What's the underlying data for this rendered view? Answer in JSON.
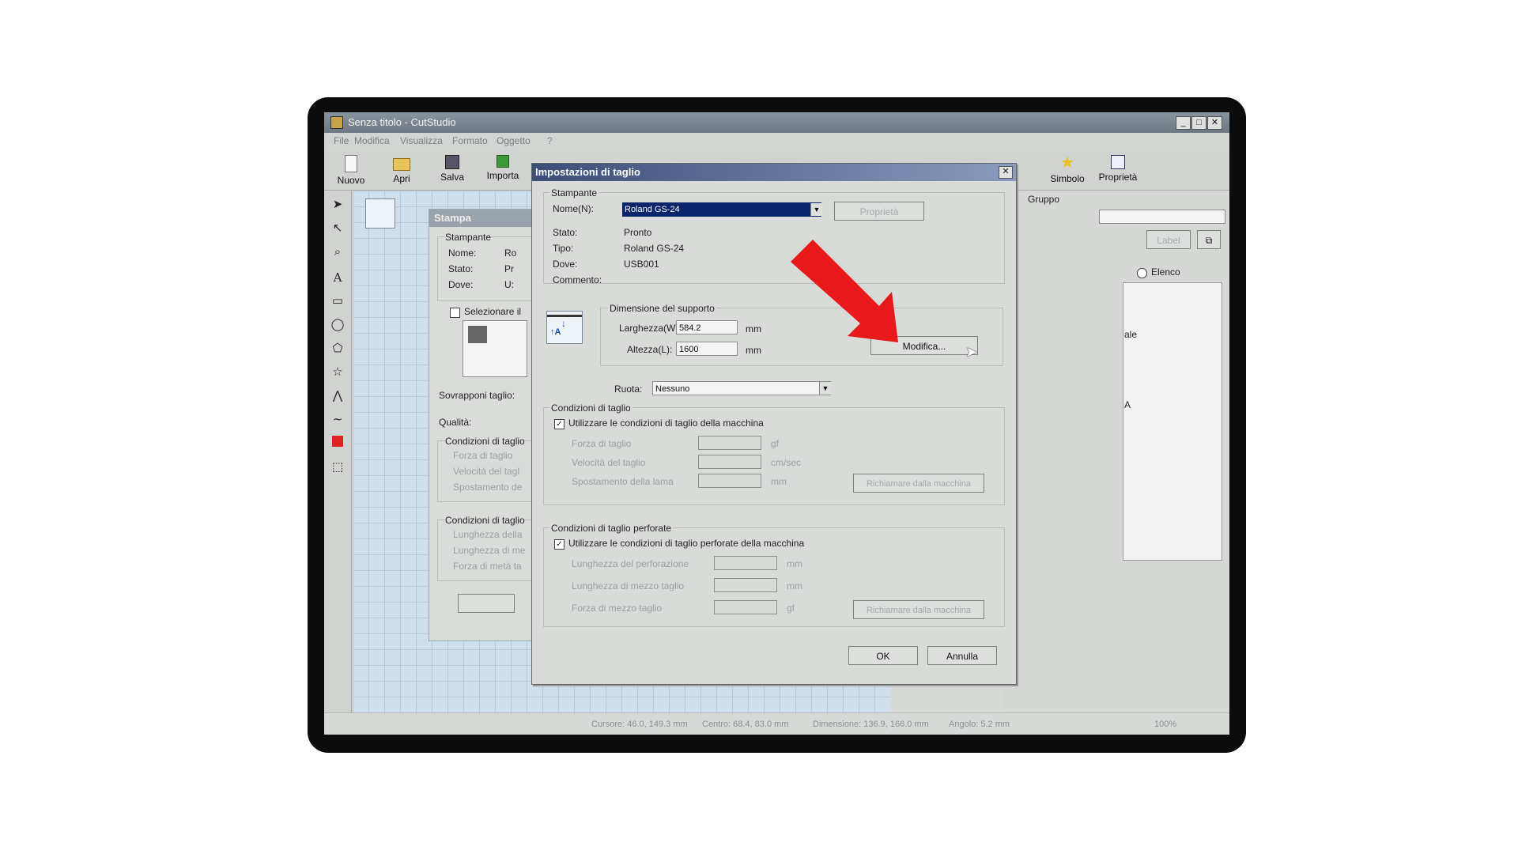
{
  "window": {
    "title": "Senza titolo - CutStudio"
  },
  "menu": [
    "File",
    "Modifica",
    "Visualizza",
    "Formato",
    "Oggetto",
    "?"
  ],
  "toolbar": {
    "buttons": [
      "Nuovo",
      "Apri",
      "Salva",
      "Importa"
    ],
    "right_buttons": [
      "Simbolo",
      "Proprietà"
    ]
  },
  "print_dialog": {
    "title": "Stampa",
    "group_printer": "Stampante",
    "name_label": "Nome:",
    "name_value": "Ro",
    "state_label": "Stato:",
    "state_value": "Pr",
    "where_label": "Dove:",
    "where_value": "U:",
    "select_label": "Selezionare il",
    "overlap_label": "Sovrapponi taglio:",
    "quality_label": "Qualità:",
    "conditions_label": "Condizioni di taglio",
    "force_label": "Forza di taglio",
    "speed_label": "Velocità del tagl",
    "offset_label": "Spostamento de",
    "perf_conditions_label": "Condizioni di taglio",
    "perf_line1": "Lunghezza della",
    "perf_line2": "Lunghezza di me",
    "perf_line3": "Forza di metà ta"
  },
  "right_panel": {
    "group_label": "Gruppo",
    "label_btn": "Label",
    "elenco": "Elenco",
    "side_text1": "ale",
    "side_text2": "A"
  },
  "dialog": {
    "title": "Impostazioni di taglio",
    "printer_group": "Stampante",
    "name_label": "Nome(N):",
    "name_value": "Roland GS-24",
    "properties_button": "Proprietà",
    "state_label": "Stato:",
    "state_value": "Pronto",
    "type_label": "Tipo:",
    "type_value": "Roland GS-24",
    "where_label": "Dove:",
    "where_value": "USB001",
    "comment_label": "Commento:",
    "media_group": "Dimensione del supporto",
    "width_label": "Larghezza(W):",
    "width_value": "584.2",
    "height_label": "Altezza(L):",
    "height_value": "1600",
    "unit": "mm",
    "modify_button": "Modifica...",
    "rotate_label": "Ruota:",
    "rotate_value": "Nessuno",
    "cut_group": "Condizioni di taglio",
    "cut_checkbox": "Utilizzare le condizioni di taglio della macchina",
    "cut_force": "Forza di taglio",
    "cut_speed": "Velocità del taglio",
    "cut_offset": "Spostamento della lama",
    "cut_unit1": "gf",
    "cut_unit2": "cm/sec",
    "cut_unit3": "mm",
    "cut_machine_btn": "Richiamare dalla macchina",
    "perf_group": "Condizioni di taglio perforate",
    "perf_checkbox": "Utilizzare le condizioni di taglio perforate della macchina",
    "perf_len": "Lunghezza del perforazione",
    "perf_half": "Lunghezza di mezzo taglio",
    "perf_force": "Forza di mezzo taglio",
    "perf_unit1": "mm",
    "perf_unit2": "mm",
    "perf_unit3": "gf",
    "perf_machine_btn": "Richiamare dalla macchina",
    "ok_button": "OK",
    "cancel_button": "Annulla"
  },
  "statusbar": {
    "cursor": "Cursore: 46.0, 149.3 mm",
    "center": "Centro: 68.4, 83.0 mm",
    "dimension": "Dimensione: 136.9, 166.0 mm",
    "angle": "Angolo: 5.2 mm",
    "zoom": "100%"
  },
  "colors": {
    "arrow": "#e8191b",
    "selection": "#0a246a",
    "titlebar": "#3b4e78"
  }
}
